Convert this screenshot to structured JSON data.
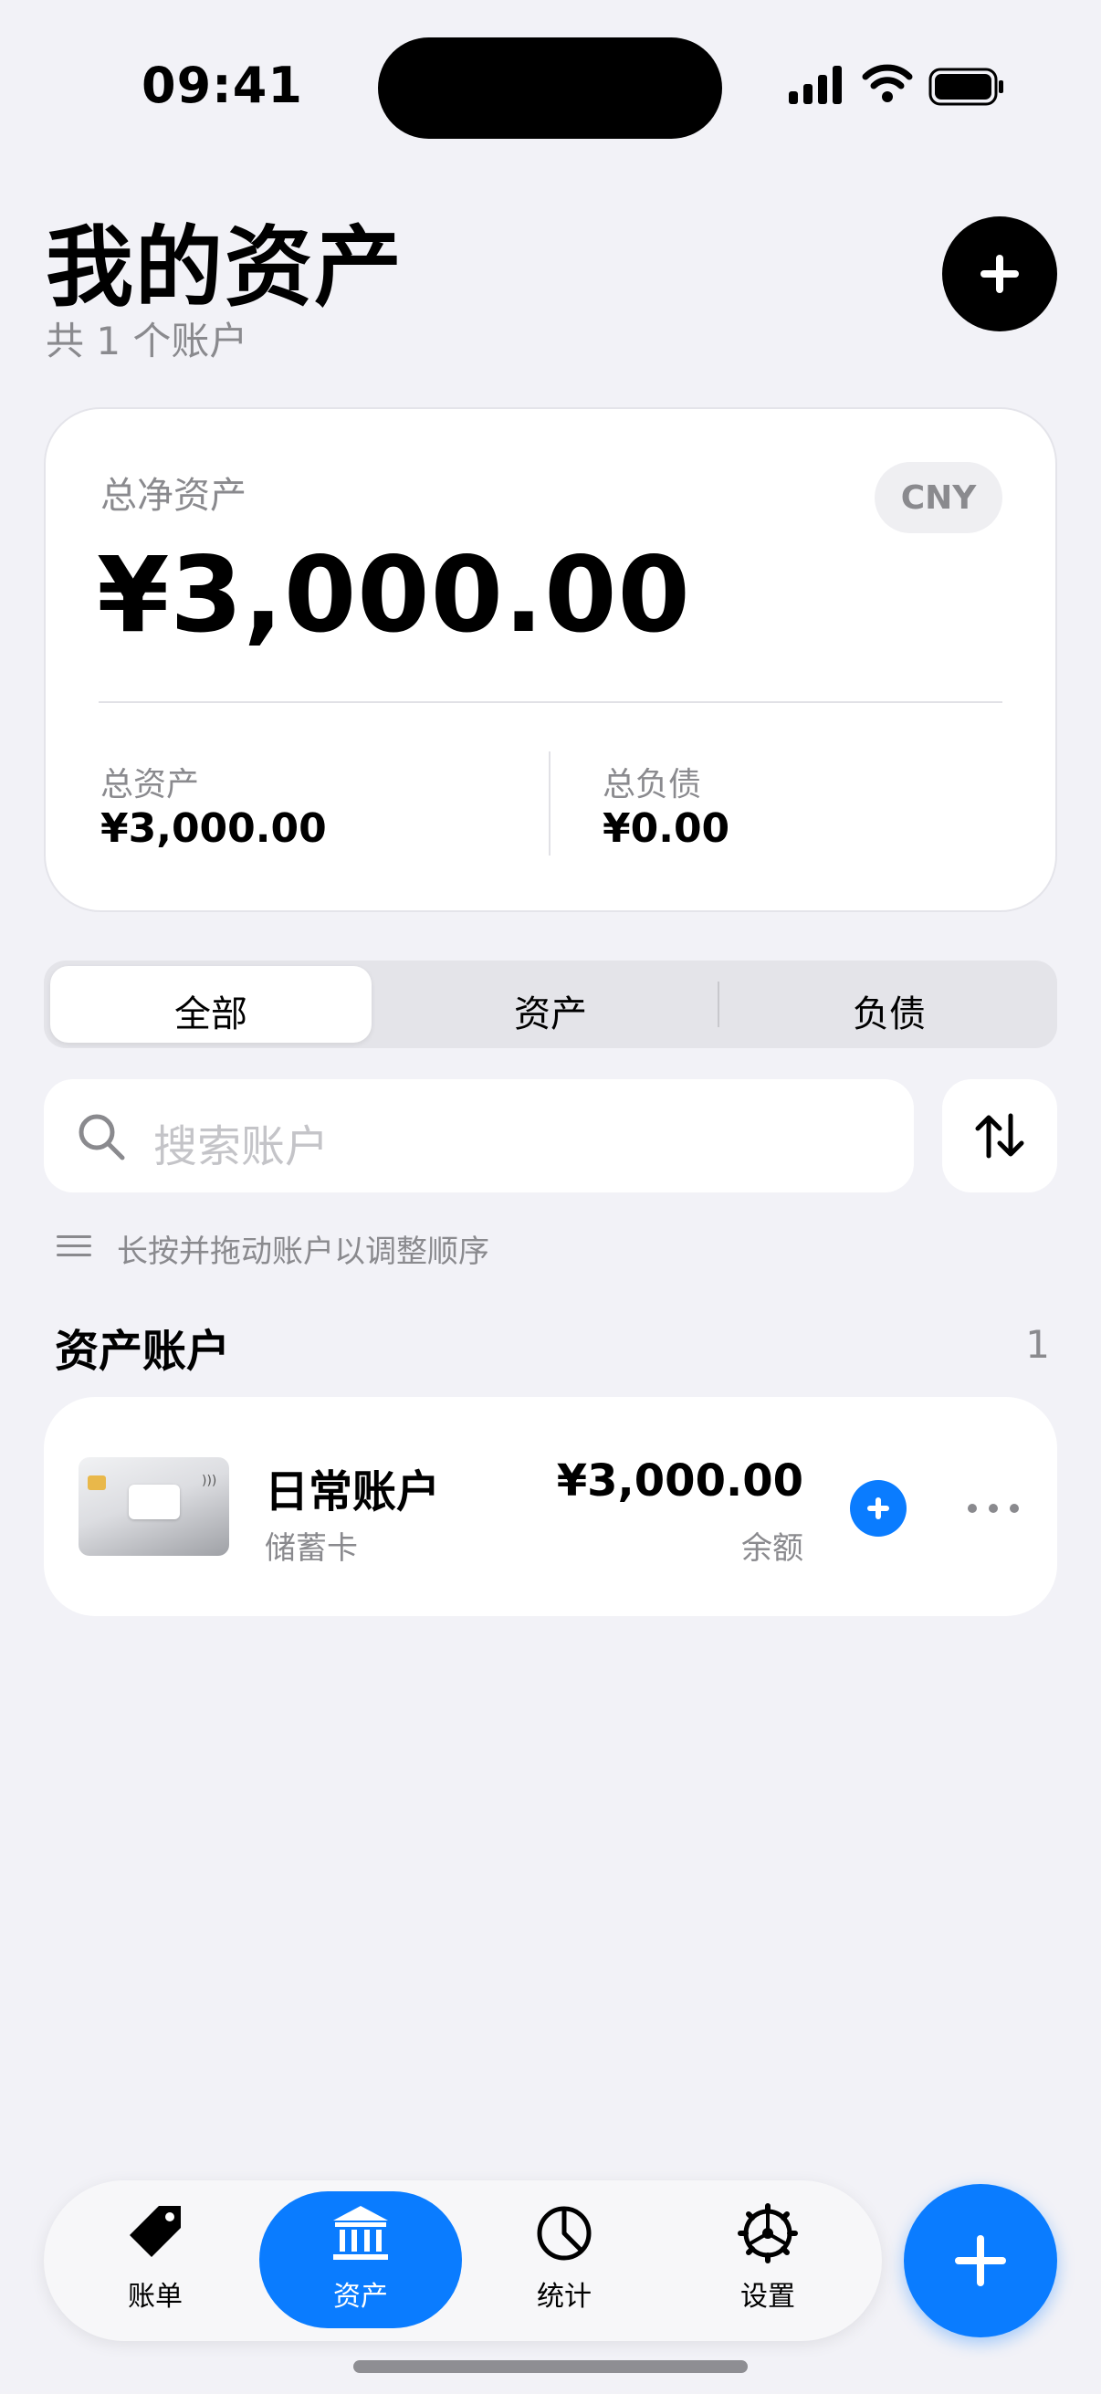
{
  "status_bar": {
    "time": "09:41"
  },
  "header": {
    "title": "我的资产",
    "subtitle": "共 1 个账户"
  },
  "summary": {
    "net_label": "总净资产",
    "currency": "CNY",
    "net_value": "¥3,000.00",
    "assets_label": "总资产",
    "assets_value": "¥3,000.00",
    "liabilities_label": "总负债",
    "liabilities_value": "¥0.00"
  },
  "segments": [
    {
      "label": "全部",
      "active": true
    },
    {
      "label": "资产",
      "active": false
    },
    {
      "label": "负债",
      "active": false
    }
  ],
  "search": {
    "placeholder": "搜索账户"
  },
  "hint": {
    "text": "长按并拖动账户以调整顺序"
  },
  "section": {
    "title": "资产账户",
    "count": "1"
  },
  "accounts": [
    {
      "name": "日常账户",
      "type": "储蓄卡",
      "balance": "¥3,000.00",
      "balance_label": "余额"
    }
  ],
  "tab_bar": {
    "items": [
      {
        "label": "账单",
        "icon": "tag-icon",
        "active": false
      },
      {
        "label": "资产",
        "icon": "bank-icon",
        "active": true
      },
      {
        "label": "统计",
        "icon": "pie-chart-icon",
        "active": false
      },
      {
        "label": "设置",
        "icon": "gear-icon",
        "active": false
      }
    ]
  },
  "colors": {
    "accent": "#0a7cff",
    "background": "#f2f2f7",
    "secondary_text": "#8a8a8e"
  }
}
